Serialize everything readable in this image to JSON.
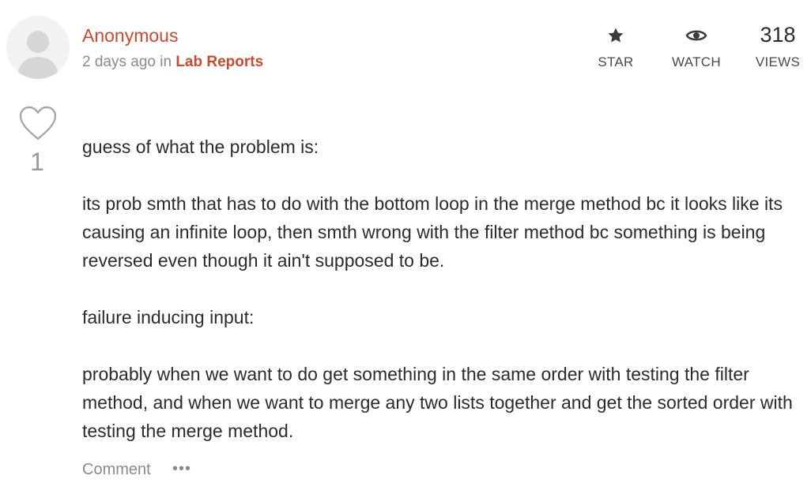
{
  "post": {
    "author": "Anonymous",
    "time_ago": "2 days ago",
    "in_word": "in",
    "category": "Lab Reports"
  },
  "stats": {
    "star_label": "STAR",
    "watch_label": "WATCH",
    "views_count": "318",
    "views_label": "VIEWS"
  },
  "likes": {
    "count": "1"
  },
  "body": {
    "paragraphs": [
      "guess of what the problem is:",
      "its prob smth that has to do with the bottom loop in the merge method bc it looks like its causing an infinite loop, then smth wrong with the filter method bc something is being reversed even though it ain't supposed to be.",
      "failure inducing input:",
      "probably when we want to do get something in the same order with testing the filter method, and when we want to merge any two lists together and get the sorted order with testing the merge method."
    ]
  },
  "actions": {
    "comment_label": "Comment",
    "more_label": "•••"
  },
  "icons": {
    "avatar": "user-avatar-icon",
    "star": "star-icon",
    "watch": "eye-icon",
    "like": "heart-icon"
  },
  "colors": {
    "accent": "#c94a2c",
    "text": "#2b2b2b",
    "muted": "#8a8a8a"
  }
}
